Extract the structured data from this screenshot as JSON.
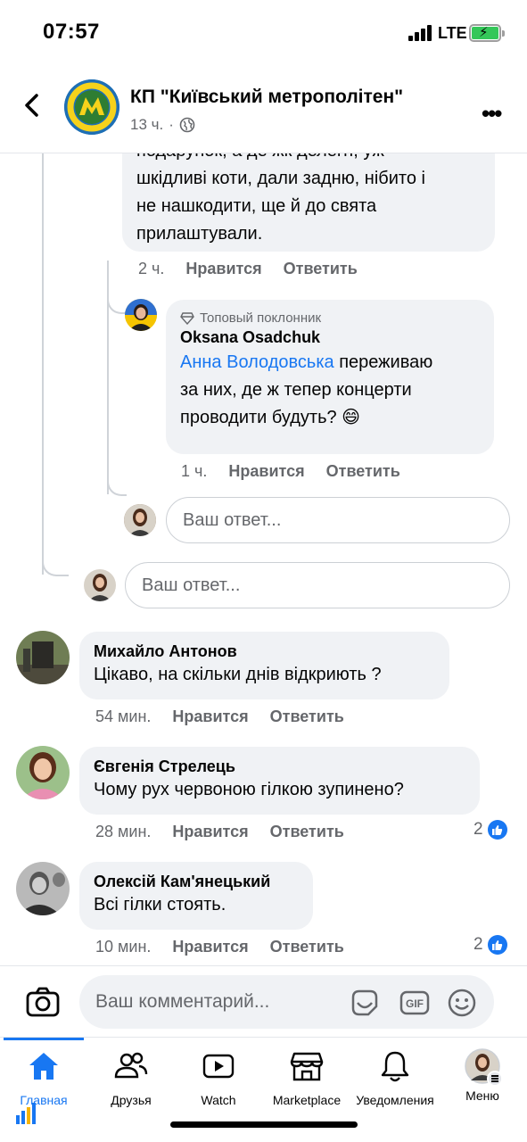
{
  "status": {
    "time": "07:57",
    "network": "LTE"
  },
  "header": {
    "title": "КП \"Київський метрополітен\"",
    "age": "13 ч."
  },
  "thread": {
    "partial_comment": {
      "lines": [
        "подарунок, а де жк делегн, уж",
        "шкідливі коти, дали задню, нібито і",
        "не нашкодити, ще й до свята",
        "прилаштували."
      ],
      "age": "2 ч.",
      "like": "Нравится",
      "reply": "Ответить"
    },
    "reply_comment": {
      "badge": "Топовый поклонник",
      "author": "Oksana Osadchuk",
      "mention": "Анна Володовська",
      "line1_rest": " переживаю",
      "line2": "за них, де ж тепер концерти",
      "line3": "проводити будуть? 😄",
      "age": "1 ч.",
      "like": "Нравится",
      "reply": "Ответить"
    },
    "reply_box_1": "Ваш ответ...",
    "reply_box_2": "Ваш ответ..."
  },
  "comments": [
    {
      "author": "Михайло Антонов",
      "text": "Цікаво, на скільки днів відкриють ?",
      "age": "54 мин.",
      "like": "Нравится",
      "reply": "Ответить",
      "likes": ""
    },
    {
      "author": "Євгенія Стрелець",
      "text": "Чому рух червоною гілкою зупинено?",
      "age": "28 мин.",
      "like": "Нравится",
      "reply": "Ответить",
      "likes": "2"
    },
    {
      "author": "Олексій Кам'янецький",
      "text": "Всі гілки стоять.",
      "age": "10 мин.",
      "like": "Нравится",
      "reply": "Ответить",
      "likes": "2"
    }
  ],
  "composer": {
    "placeholder": "Ваш комментарий..."
  },
  "tabs": [
    {
      "label": "Главная",
      "icon": "home-icon"
    },
    {
      "label": "Друзья",
      "icon": "friends-icon"
    },
    {
      "label": "Watch",
      "icon": "watch-icon"
    },
    {
      "label": "Marketplace",
      "icon": "marketplace-icon"
    },
    {
      "label": "Уведомления",
      "icon": "bell-icon"
    },
    {
      "label": "Меню",
      "icon": "menu-avatar"
    }
  ],
  "colors": {
    "accent": "#1877f2",
    "bubble": "#f0f2f5",
    "secondary_text": "#65676b",
    "battery": "#34c759"
  }
}
